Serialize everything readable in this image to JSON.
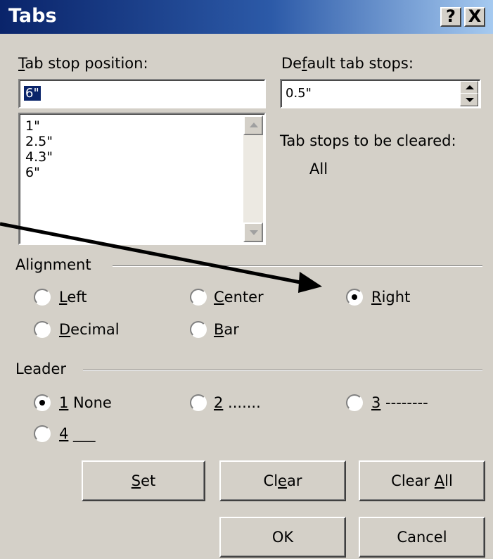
{
  "dialog": {
    "title": "Tabs",
    "help_button": "?",
    "close_button": "X"
  },
  "tab_stop": {
    "label_accel": "T",
    "label_rest": "ab stop position:",
    "value": "6\"",
    "list": [
      "1\"",
      "2.5\"",
      "4.3\"",
      "6\""
    ]
  },
  "default_tabs": {
    "label_pre": "De",
    "label_accel": "f",
    "label_rest": "ault tab stops:",
    "value": "0.5\""
  },
  "to_clear": {
    "label": "Tab stops to be cleared:",
    "value": "All"
  },
  "alignment": {
    "group_label": "Alignment",
    "options": [
      {
        "accel": "L",
        "rest": "eft",
        "selected": false
      },
      {
        "accel": "C",
        "rest": "enter",
        "selected": false
      },
      {
        "accel": "R",
        "rest": "ight",
        "selected": true
      },
      {
        "accel": "D",
        "rest": "ecimal",
        "selected": false
      },
      {
        "accel": "B",
        "rest": "ar",
        "selected": false
      }
    ]
  },
  "leader": {
    "group_label": "Leader",
    "options": [
      {
        "accel": "1",
        "rest": " None",
        "selected": true
      },
      {
        "accel": "2",
        "rest": " .......",
        "selected": false
      },
      {
        "accel": "3",
        "rest": " --------",
        "selected": false
      },
      {
        "accel": "4",
        "rest": " ___",
        "selected": false
      }
    ]
  },
  "buttons": {
    "set": {
      "accel": "S",
      "rest": "et"
    },
    "clear": {
      "pre": "Cl",
      "accel": "e",
      "rest": "ar"
    },
    "clear_all": {
      "pre": "Clear ",
      "accel": "A",
      "rest": "ll"
    },
    "ok": "OK",
    "cancel": "Cancel"
  },
  "annotation": {
    "type": "arrow",
    "points_to": "alignment-right-radio"
  }
}
